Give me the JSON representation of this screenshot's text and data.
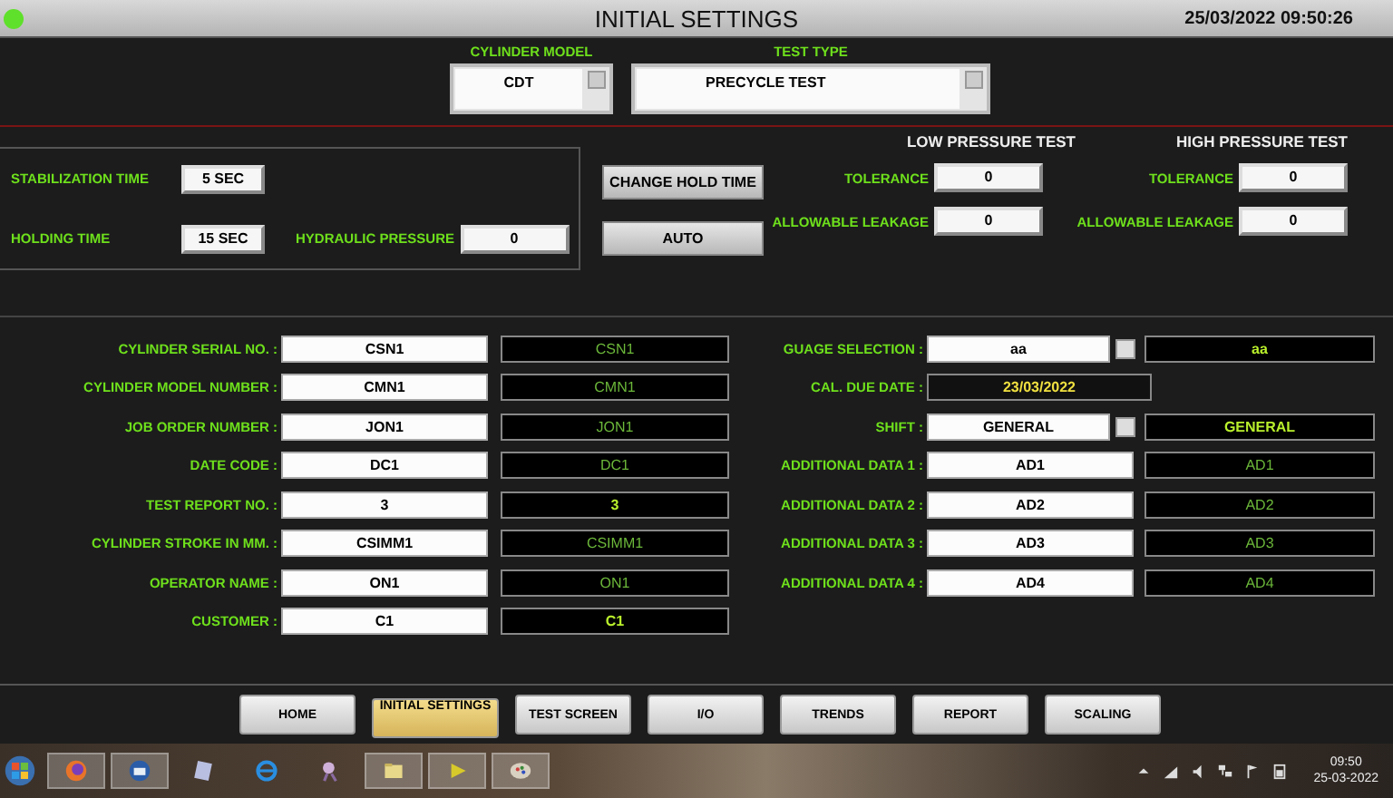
{
  "window": {
    "title": "INITIAL SETTINGS",
    "datetime": "25/03/2022 09:50:26",
    "status_on": true
  },
  "selectors": [
    {
      "label": "CYLINDER MODEL",
      "value": "CDT",
      "kind": "model"
    },
    {
      "label": "TEST TYPE",
      "value": "PRECYCLE TEST",
      "kind": "type"
    }
  ],
  "timing": {
    "stabilization_label": "STABILIZATION TIME",
    "stabilization_value": "5 SEC",
    "holding_label": "HOLDING TIME",
    "holding_value": "15 SEC",
    "pressure_label": "HYDRAULIC PRESSURE",
    "pressure_value": "0"
  },
  "actions": [
    "CHANGE HOLD TIME",
    "AUTO"
  ],
  "pressure_tests": [
    {
      "title": "LOW PRESSURE TEST",
      "tolerance_label": "TOLERANCE",
      "tolerance": "0",
      "leakage_label": "ALLOWABLE LEAKAGE",
      "leakage": "0"
    },
    {
      "title": "HIGH PRESSURE TEST",
      "tolerance_label": "TOLERANCE",
      "tolerance": "0",
      "leakage_label": "ALLOWABLE LEAKAGE",
      "leakage": "0"
    }
  ],
  "left_fields": [
    {
      "label": "CYLINDER SERIAL NO. :",
      "value": "CSN1",
      "echo": "CSN1",
      "emphasis": false
    },
    {
      "label": "CYLINDER MODEL NUMBER :",
      "value": "CMN1",
      "echo": "CMN1",
      "emphasis": false
    },
    {
      "label": "JOB ORDER NUMBER :",
      "value": "JON1",
      "echo": "JON1",
      "emphasis": false
    },
    {
      "label": "DATE CODE :",
      "value": "DC1",
      "echo": "DC1",
      "emphasis": false
    },
    {
      "label": "TEST REPORT NO. :",
      "value": "3",
      "echo": "3",
      "emphasis": true
    },
    {
      "label": "CYLINDER STROKE IN MM. :",
      "value": "CSIMM1",
      "echo": "CSIMM1",
      "emphasis": false
    },
    {
      "label": "OPERATOR NAME :",
      "value": "ON1",
      "echo": "ON1",
      "emphasis": false
    },
    {
      "label": "CUSTOMER :",
      "value": "C1",
      "echo": "C1",
      "emphasis": true
    }
  ],
  "right_fields": [
    {
      "kind": "dropdown",
      "label": "GUAGE SELECTION :",
      "value": "aa",
      "echo": "aa",
      "emphasis": true
    },
    {
      "kind": "date",
      "label": "CAL. DUE DATE :",
      "value": "23/03/2022"
    },
    {
      "kind": "dropdown",
      "label": "SHIFT :",
      "value": "GENERAL",
      "echo": "GENERAL",
      "emphasis": true
    },
    {
      "kind": "text",
      "label": "ADDITIONAL DATA 1 :",
      "value": "AD1",
      "echo": "AD1",
      "emphasis": false
    },
    {
      "kind": "text",
      "label": "ADDITIONAL DATA 2 :",
      "value": "AD2",
      "echo": "AD2",
      "emphasis": false
    },
    {
      "kind": "text",
      "label": "ADDITIONAL DATA 3 :",
      "value": "AD3",
      "echo": "AD3",
      "emphasis": false
    },
    {
      "kind": "text",
      "label": "ADDITIONAL DATA 4 :",
      "value": "AD4",
      "echo": "AD4",
      "emphasis": false
    }
  ],
  "nav": [
    {
      "label": "HOME",
      "selected": false
    },
    {
      "label": "INITIAL SETTINGS",
      "selected": true
    },
    {
      "label": "TEST SCREEN",
      "selected": false
    },
    {
      "label": "I/O",
      "selected": false
    },
    {
      "label": "TRENDS",
      "selected": false
    },
    {
      "label": "REPORT",
      "selected": false
    },
    {
      "label": "SCALING",
      "selected": false
    }
  ],
  "taskbar": {
    "time": "09:50",
    "date": "25-03-2022"
  }
}
